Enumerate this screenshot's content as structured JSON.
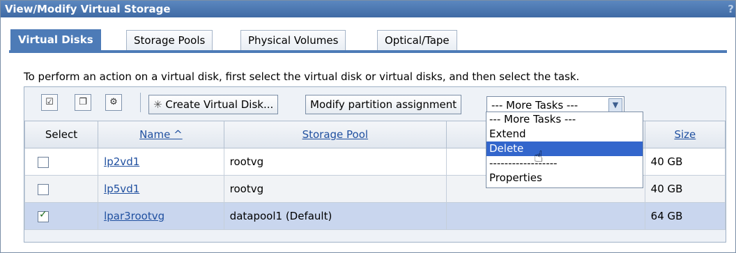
{
  "window": {
    "title": "View/Modify Virtual Storage",
    "help": "?"
  },
  "tabs": [
    {
      "label": "Virtual Disks"
    },
    {
      "label": "Storage Pools"
    },
    {
      "label": "Physical Volumes"
    },
    {
      "label": "Optical/Tape"
    }
  ],
  "instruction": "To perform an action on a virtual disk, first select the virtual disk or virtual disks, and then select the task.",
  "toolbar": {
    "create_label": "Create Virtual Disk...",
    "modify_label": "Modify partition assignment",
    "more_tasks_value": "--- More Tasks ---"
  },
  "table": {
    "headers": {
      "select": "Select",
      "name": "Name ^",
      "pool": "Storage Pool",
      "assigned": "",
      "size": "Size"
    },
    "rows": [
      {
        "name": "lp2vd1",
        "pool": "rootvg",
        "assigned": "",
        "size": "40 GB",
        "checked": false
      },
      {
        "name": "lp5vd1",
        "pool": "rootvg",
        "assigned": "",
        "size": "40 GB",
        "checked": false
      },
      {
        "name": "lpar3rootvg",
        "pool": "datapool1 (Default)",
        "assigned": "",
        "size": "64 GB",
        "checked": true
      }
    ]
  },
  "dropdown": {
    "options": [
      "--- More Tasks ---",
      "Extend",
      "Delete",
      "------------------",
      "Properties"
    ],
    "selected": "Delete"
  }
}
